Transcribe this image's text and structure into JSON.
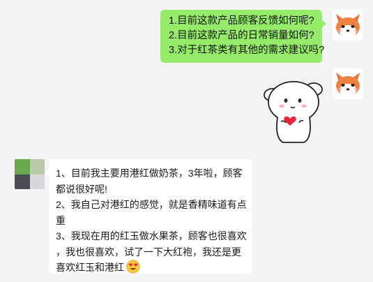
{
  "chat": {
    "outgoing_message": {
      "lines": [
        "1.目前这款产品顾客反馈如何呢?",
        "2.目前这款产品的日常销量如何?",
        "3.对于红茶类有其他的需求建议吗?"
      ]
    },
    "sticker": {
      "icon": "cute-dog-holding-heart-sticker"
    },
    "incoming_message": {
      "lines": [
        "1、目前我主要用港红做奶茶，3年啦，顾客",
        "都说很好呢!",
        "2、我自己对港红的感觉，就是香精味道有点",
        "重",
        "3、我现在用的红玉做水果茶，顾客也很喜欢",
        "，我也很喜欢，试了一下大红袍，我还是更",
        "喜欢红玉和港红"
      ],
      "emoji": "heart-eyes-emoji"
    },
    "avatars": {
      "self": "fox-avatar-icon",
      "other_colors": [
        "#6aa84f",
        "#b7c9a8",
        "#4a4a55",
        "#d8d8dc"
      ]
    }
  }
}
